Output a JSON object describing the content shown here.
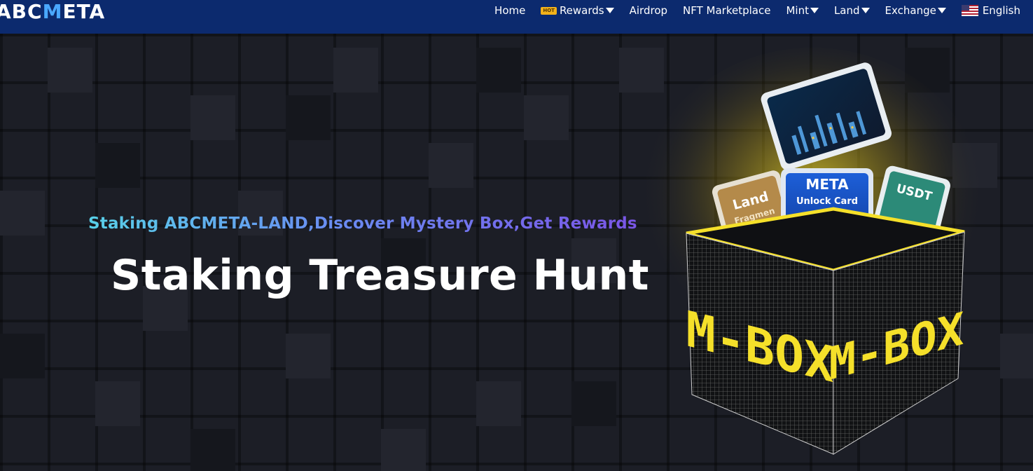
{
  "nav": {
    "logo": {
      "prefix": "ABC",
      "m": "M",
      "suffix": "ETA"
    },
    "items": [
      {
        "label": "Home",
        "dropdown": false,
        "hot": false
      },
      {
        "label": "Rewards",
        "dropdown": true,
        "hot": true,
        "hot_label": "HOT"
      },
      {
        "label": "Airdrop",
        "dropdown": false,
        "hot": false
      },
      {
        "label": "NFT Marketplace",
        "dropdown": false,
        "hot": false
      },
      {
        "label": "Mint",
        "dropdown": true,
        "hot": false
      },
      {
        "label": "Land",
        "dropdown": true,
        "hot": false
      },
      {
        "label": "Exchange",
        "dropdown": true,
        "hot": false
      }
    ],
    "language": {
      "label": "English",
      "icon": "us-flag-icon"
    }
  },
  "hero": {
    "subtitle": "Staking ABCMETA-LAND,Discover Mystery Box,Get Rewards",
    "title": "Staking Treasure Hunt",
    "art": {
      "box_text_left": "M-BOX",
      "box_text_right": "M-BOX",
      "card_meta_title": "META",
      "card_meta_sub": "Unlock Card",
      "card_land_title": "Land",
      "card_land_sub": "Fragmen",
      "card_usdt_title": "USDT"
    }
  },
  "colors": {
    "nav_bg": "#0c2a6e",
    "hero_bg": "#1c1e26",
    "accent_yellow": "#f5e02a",
    "hot_badge": "#f3b21a"
  }
}
